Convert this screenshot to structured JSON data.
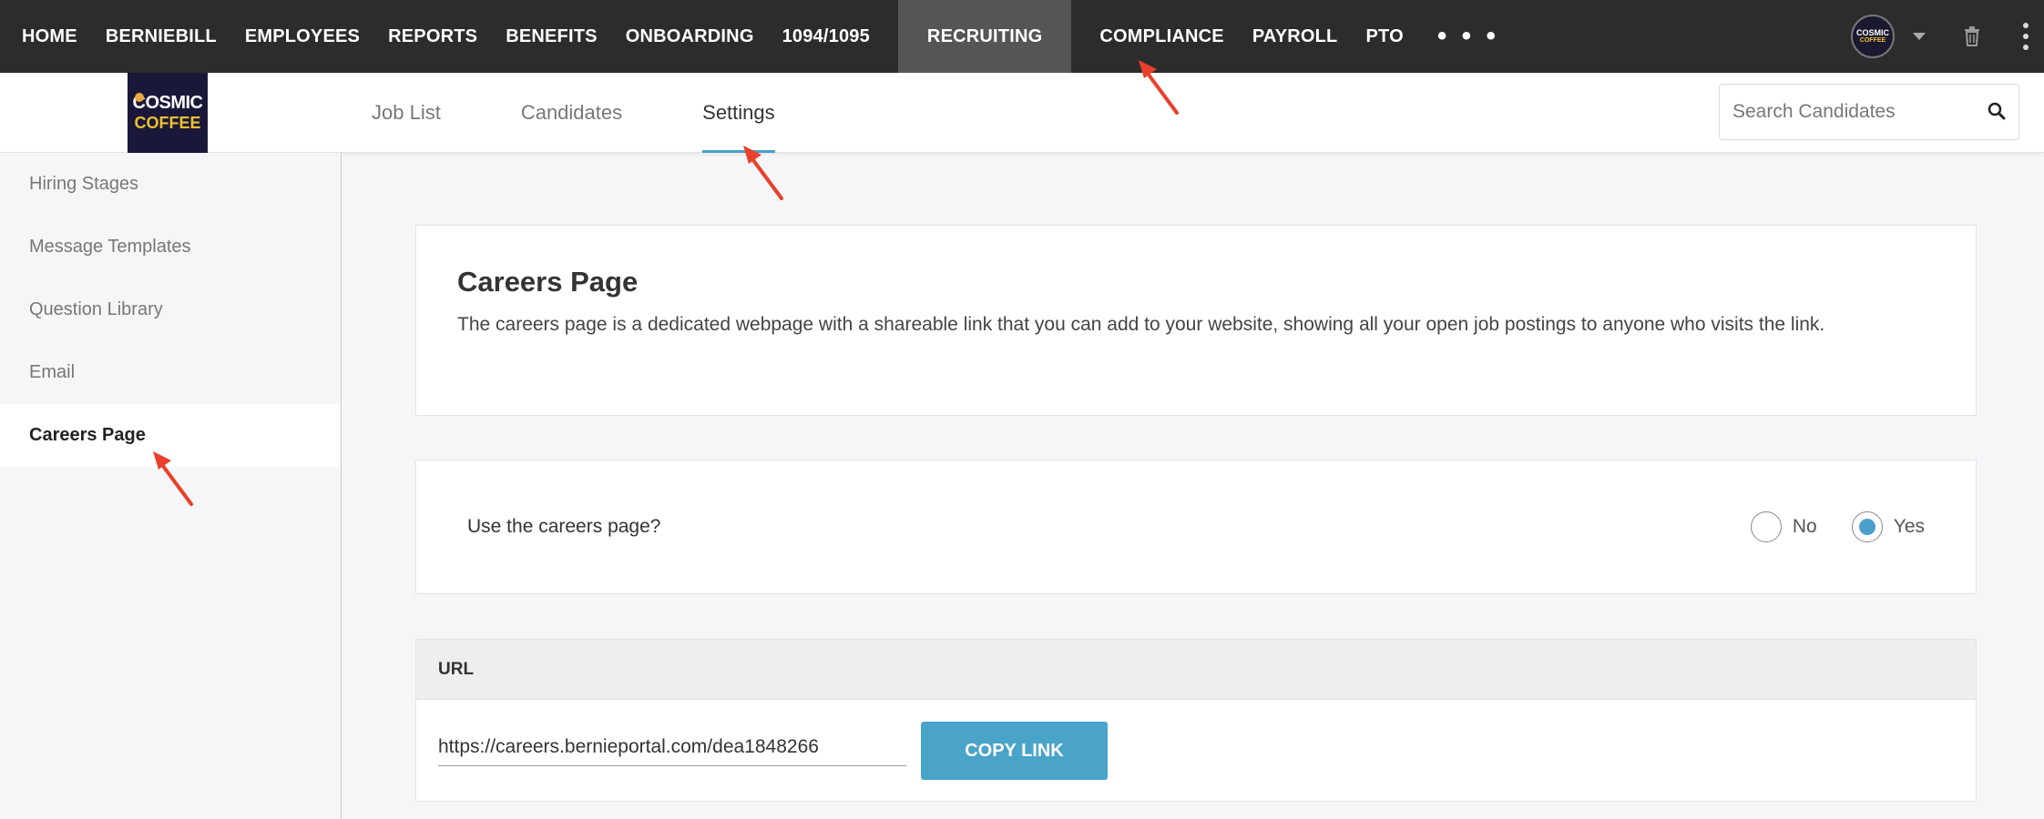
{
  "topnav": {
    "items": [
      "HOME",
      "BERNIEBILL",
      "EMPLOYEES",
      "REPORTS",
      "BENEFITS",
      "ONBOARDING",
      "1094/1095",
      "RECRUITING",
      "COMPLIANCE",
      "PAYROLL",
      "PTO"
    ],
    "active": "RECRUITING",
    "more": "• • •",
    "avatar_line1": "COSMIC",
    "avatar_line2": "COFFEE"
  },
  "logo": {
    "line1": "COSMIC",
    "line2": "COFFEE"
  },
  "subnav": {
    "tabs": [
      "Job List",
      "Candidates",
      "Settings"
    ],
    "active": "Settings"
  },
  "search": {
    "placeholder": "Search Candidates",
    "value": ""
  },
  "sidebar": {
    "items": [
      "Hiring Stages",
      "Message Templates",
      "Question Library",
      "Email",
      "Careers Page"
    ],
    "active": "Careers Page"
  },
  "careers": {
    "title": "Careers Page",
    "description": "The careers page is a dedicated webpage with a shareable link that you can add to your website, showing all your open job postings to anyone who visits the link."
  },
  "use_careers": {
    "question": "Use the careers page?",
    "options": [
      "No",
      "Yes"
    ],
    "selected": "Yes"
  },
  "url_section": {
    "header": "URL",
    "value": "https://careers.bernieportal.com/dea1848266",
    "copy_label": "COPY LINK"
  },
  "colors": {
    "accent": "#4a9fcb",
    "nav_bg": "#2c2c2c",
    "annotation": "#e8402a"
  }
}
